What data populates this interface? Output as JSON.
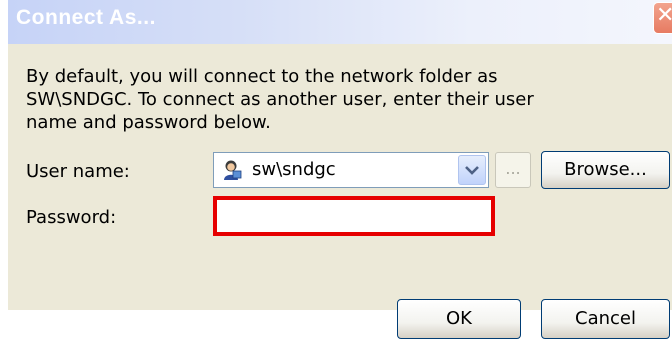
{
  "window": {
    "title": "Connect As...",
    "close_label": "✕"
  },
  "description": "By default, you will connect to the network folder as SW\\SNDGC. To connect as another user, enter their user name and password below.",
  "form": {
    "username_label": "User name:",
    "username_value": "sw\\sndgc",
    "ellipsis_label": "...",
    "browse_label": "Browse...",
    "password_label": "Password:",
    "password_value": ""
  },
  "buttons": {
    "ok_label": "OK",
    "cancel_label": "Cancel"
  },
  "colors": {
    "highlight_border": "#e60000",
    "dialog_face": "#ece9d8",
    "button_border": "#003c74"
  },
  "icons": {
    "user": "user-icon",
    "dropdown": "chevron-down-icon",
    "close": "close-icon"
  }
}
